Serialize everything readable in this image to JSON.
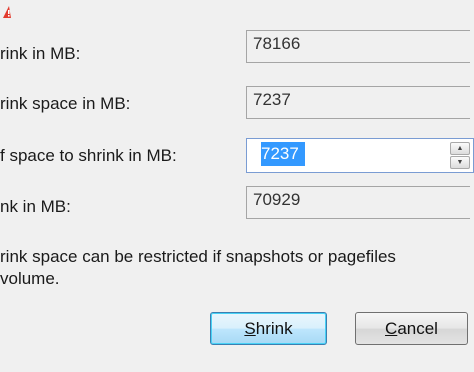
{
  "fields": [
    {
      "label": "rink in MB:",
      "value": "78166"
    },
    {
      "label": "rink space in MB:",
      "value": "7237"
    },
    {
      "label": "f space to shrink in MB:",
      "value": "7237"
    },
    {
      "label": "nk in MB:",
      "value": "70929"
    }
  ],
  "note": {
    "line1": "rink space can be restricted if snapshots or pagefiles",
    "line2": "volume."
  },
  "buttons": {
    "shrink": {
      "mnemonic": "S",
      "rest": "hrink"
    },
    "cancel": {
      "mnemonic": "C",
      "rest": "ancel"
    }
  },
  "icons": {
    "warning": "warning-icon",
    "spin_up": "spin-up-arrow",
    "spin_down": "spin-down-arrow"
  },
  "colors": {
    "selection": "#3399ff",
    "focus_border": "#3c7fb1"
  }
}
